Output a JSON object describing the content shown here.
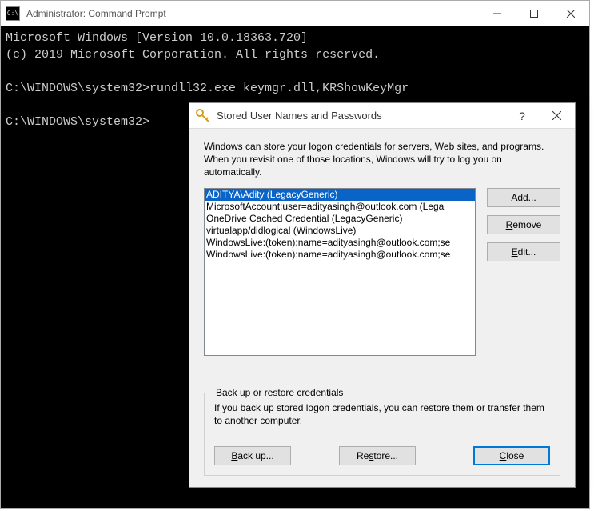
{
  "cmd": {
    "title": "Administrator: Command Prompt",
    "line1": "Microsoft Windows [Version 10.0.18363.720]",
    "line2": "(c) 2019 Microsoft Corporation. All rights reserved.",
    "prompt1": "C:\\WINDOWS\\system32>rundll32.exe keymgr.dll,KRShowKeyMgr",
    "prompt2": "C:\\WINDOWS\\system32>"
  },
  "dialog": {
    "title": "Stored User Names and Passwords",
    "desc": "Windows can store your logon credentials for servers, Web sites, and programs. When you revisit one of those locations, Windows will try to log you on automatically.",
    "items": [
      "ADITYA\\Adity (LegacyGeneric)",
      "MicrosoftAccount:user=adityasingh@outlook.com (Lega",
      "OneDrive Cached Credential (LegacyGeneric)",
      "virtualapp/didlogical (WindowsLive)",
      "WindowsLive:(token):name=adityasingh@outlook.com;se",
      "WindowsLive:(token):name=adityasingh@outlook.com;se"
    ],
    "buttons": {
      "add": "Add...",
      "remove": "Remove",
      "edit": "Edit...",
      "backup": "Back up...",
      "restore": "Restore...",
      "close": "Close"
    },
    "group": {
      "legend": "Back up or restore credentials",
      "desc": "If you back up stored logon credentials, you can restore them or transfer them to another computer."
    }
  }
}
